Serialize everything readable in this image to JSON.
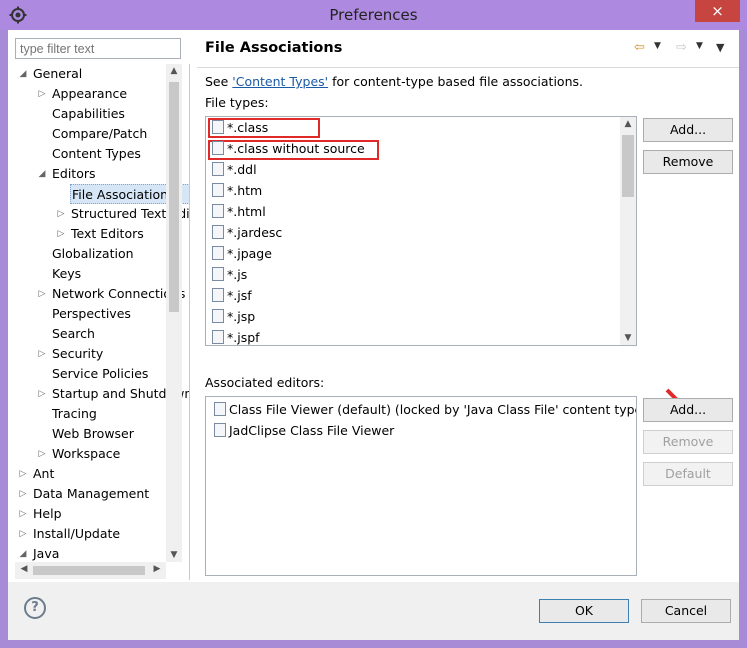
{
  "window": {
    "title": "Preferences",
    "close_label": "×"
  },
  "filter": {
    "placeholder": "type filter text"
  },
  "tree": [
    {
      "label": "General",
      "level": 0,
      "twisty": "◢"
    },
    {
      "label": "Appearance",
      "level": 1,
      "twisty": "▷"
    },
    {
      "label": "Capabilities",
      "level": 1,
      "twisty": ""
    },
    {
      "label": "Compare/Patch",
      "level": 1,
      "twisty": ""
    },
    {
      "label": "Content Types",
      "level": 1,
      "twisty": ""
    },
    {
      "label": "Editors",
      "level": 1,
      "twisty": "◢"
    },
    {
      "label": "File Associations",
      "level": 2,
      "twisty": "",
      "selected": true
    },
    {
      "label": "Structured Text Editors",
      "level": 2,
      "twisty": "▷"
    },
    {
      "label": "Text Editors",
      "level": 2,
      "twisty": "▷"
    },
    {
      "label": "Globalization",
      "level": 1,
      "twisty": ""
    },
    {
      "label": "Keys",
      "level": 1,
      "twisty": ""
    },
    {
      "label": "Network Connections",
      "level": 1,
      "twisty": "▷"
    },
    {
      "label": "Perspectives",
      "level": 1,
      "twisty": ""
    },
    {
      "label": "Search",
      "level": 1,
      "twisty": ""
    },
    {
      "label": "Security",
      "level": 1,
      "twisty": "▷"
    },
    {
      "label": "Service Policies",
      "level": 1,
      "twisty": ""
    },
    {
      "label": "Startup and Shutdown",
      "level": 1,
      "twisty": "▷"
    },
    {
      "label": "Tracing",
      "level": 1,
      "twisty": ""
    },
    {
      "label": "Web Browser",
      "level": 1,
      "twisty": ""
    },
    {
      "label": "Workspace",
      "level": 1,
      "twisty": "▷"
    },
    {
      "label": "Ant",
      "level": 0,
      "twisty": "▷"
    },
    {
      "label": "Data Management",
      "level": 0,
      "twisty": "▷"
    },
    {
      "label": "Help",
      "level": 0,
      "twisty": "▷"
    },
    {
      "label": "Install/Update",
      "level": 0,
      "twisty": "▷"
    },
    {
      "label": "Java",
      "level": 0,
      "twisty": "◢"
    }
  ],
  "page": {
    "title": "File Associations",
    "see_prefix": "See ",
    "see_link": "'Content Types'",
    "see_suffix": " for content-type based file associations.",
    "file_types_label": "File types:",
    "associated_label": "Associated editors:"
  },
  "file_types": [
    {
      "name": "*.class",
      "icon": "class-file-icon"
    },
    {
      "name": "*.class without source",
      "icon": "class-file-icon"
    },
    {
      "name": "*.ddl",
      "icon": "ddl-file-icon"
    },
    {
      "name": "*.htm",
      "icon": "html-file-icon"
    },
    {
      "name": "*.html",
      "icon": "html-file-icon"
    },
    {
      "name": "*.jardesc",
      "icon": "jar-file-icon"
    },
    {
      "name": "*.jpage",
      "icon": "java-page-icon"
    },
    {
      "name": "*.js",
      "icon": "js-file-icon"
    },
    {
      "name": "*.jsf",
      "icon": "text-file-icon"
    },
    {
      "name": "*.jsp",
      "icon": "text-file-icon"
    },
    {
      "name": "*.jspf",
      "icon": "text-file-icon"
    }
  ],
  "editors": [
    {
      "name": "Class File Viewer (default) (locked by 'Java Class File' content type)",
      "icon": "class-viewer-icon"
    },
    {
      "name": "JadClipse Class File Viewer",
      "icon": "class-viewer-icon"
    }
  ],
  "buttons": {
    "ft_add": "Add...",
    "ft_remove": "Remove",
    "ed_add": "Add...",
    "ed_remove": "Remove",
    "ed_default": "Default",
    "ok": "OK",
    "cancel": "Cancel"
  },
  "colors": {
    "highlight": "#e02a2a",
    "selection": "#d7e6f7",
    "titlebar": "#ad8ae0"
  }
}
